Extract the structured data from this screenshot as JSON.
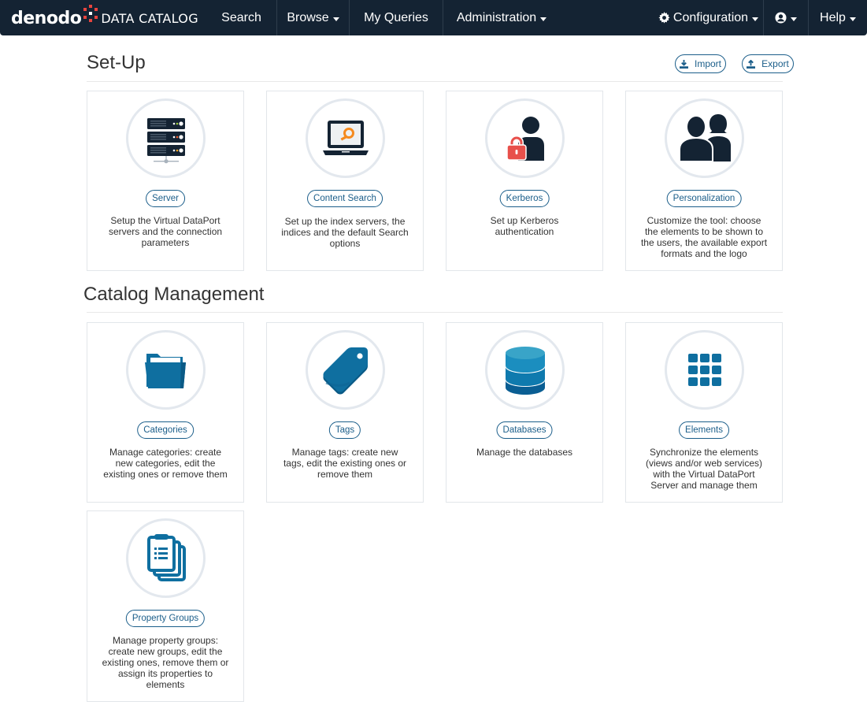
{
  "navbar": {
    "brand": "denodo",
    "product": "DATA CATALOG",
    "items": [
      {
        "label": "Search",
        "dropdown": false
      },
      {
        "label": "Browse",
        "dropdown": true
      },
      {
        "label": "My Queries",
        "dropdown": false
      },
      {
        "label": "Administration",
        "dropdown": true
      }
    ],
    "right_items": [
      {
        "label": "Configuration",
        "icon": "gear-icon",
        "dropdown": true
      },
      {
        "label": "",
        "icon": "user-circle-icon",
        "dropdown": true
      },
      {
        "label": "Help",
        "dropdown": true
      }
    ]
  },
  "setup": {
    "title": "Set-Up",
    "import_label": "Import",
    "export_label": "Export",
    "cards": [
      {
        "button": "Server",
        "icon": "server-icon",
        "description": "Setup the Virtual DataPort servers and the connection parameters"
      },
      {
        "button": "Content Search",
        "icon": "laptop-search-icon",
        "description": "Set up the index servers, the indices and the default Search options"
      },
      {
        "button": "Kerberos",
        "icon": "user-lock-icon",
        "description": "Set up Kerberos authentication"
      },
      {
        "button": "Personalization",
        "icon": "users-icon",
        "description": "Customize the tool: choose the elements to be shown to the users, the available export formats and the logo"
      }
    ]
  },
  "catalog": {
    "title": "Catalog Management",
    "cards": [
      {
        "button": "Categories",
        "icon": "folder-icon",
        "description": "Manage categories: create new categories, edit the existing ones or remove them"
      },
      {
        "button": "Tags",
        "icon": "tag-icon",
        "description": "Manage tags: create new tags, edit the existing ones or remove them"
      },
      {
        "button": "Databases",
        "icon": "database-icon",
        "description": "Manage the databases"
      },
      {
        "button": "Elements",
        "icon": "grid-icon",
        "description": "Synchronize the elements (views and/or web services) with the Virtual DataPort Server and manage them"
      },
      {
        "button": "Property Groups",
        "icon": "clipboard-list-icon",
        "description": "Manage property groups: create new groups, edit the existing ones, remove them or assign its properties to elements"
      }
    ]
  },
  "colors": {
    "navbar_bg": "#142333",
    "accent": "#1b5e8a",
    "icon_dark": "#142333",
    "icon_blue": "#0f6fa0",
    "lock_red": "#e8504b",
    "search_orange": "#f58a1f"
  }
}
